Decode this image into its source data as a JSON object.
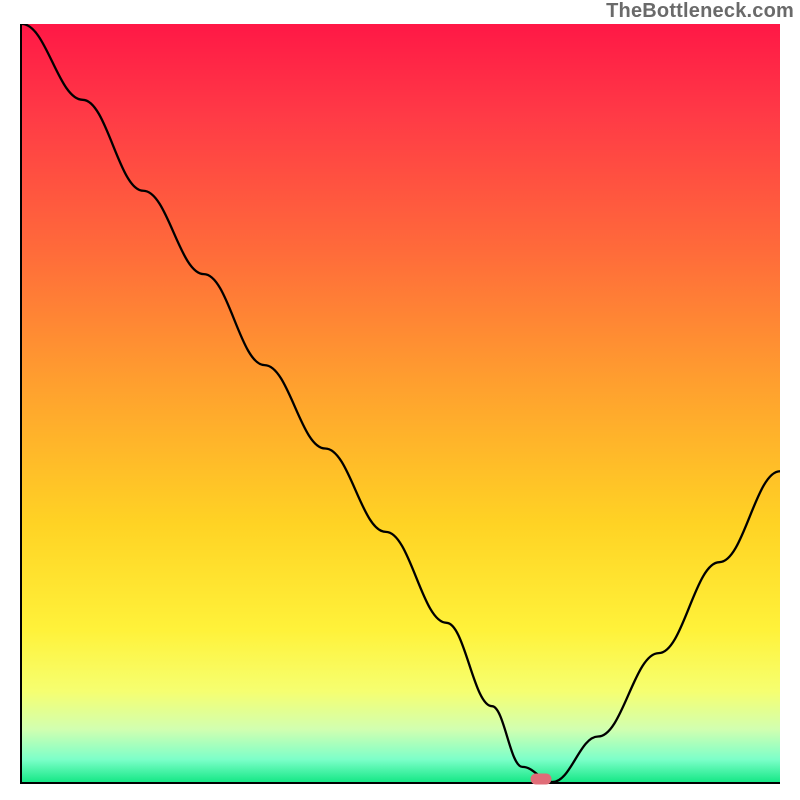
{
  "attribution": "TheBottleneck.com",
  "chart_data": {
    "type": "line",
    "title": "",
    "xlabel": "",
    "ylabel": "",
    "xlim": [
      0,
      100
    ],
    "ylim": [
      0,
      100
    ],
    "gradient_meaning": "vertical color gradient approximates bottleneck severity (top = high mismatch, bottom = balanced)",
    "series": [
      {
        "name": "bottleneck_curve",
        "x": [
          0,
          8,
          16,
          24,
          32,
          40,
          48,
          56,
          62,
          66,
          70,
          76,
          84,
          92,
          100
        ],
        "y": [
          100,
          90,
          78,
          67,
          55,
          44,
          33,
          21,
          10,
          2,
          0,
          6,
          17,
          29,
          41
        ]
      }
    ],
    "optimum_marker": {
      "x": 68.5,
      "y": 0.4
    },
    "color_stops": [
      {
        "pct": 0,
        "hex": "#ff1846"
      },
      {
        "pct": 12,
        "hex": "#ff3a46"
      },
      {
        "pct": 30,
        "hex": "#ff6b3a"
      },
      {
        "pct": 48,
        "hex": "#ffa12e"
      },
      {
        "pct": 66,
        "hex": "#ffd324"
      },
      {
        "pct": 80,
        "hex": "#fff23a"
      },
      {
        "pct": 88,
        "hex": "#f6ff70"
      },
      {
        "pct": 93,
        "hex": "#d2ffb0"
      },
      {
        "pct": 97,
        "hex": "#7dffc9"
      },
      {
        "pct": 100,
        "hex": "#17e887"
      }
    ]
  }
}
